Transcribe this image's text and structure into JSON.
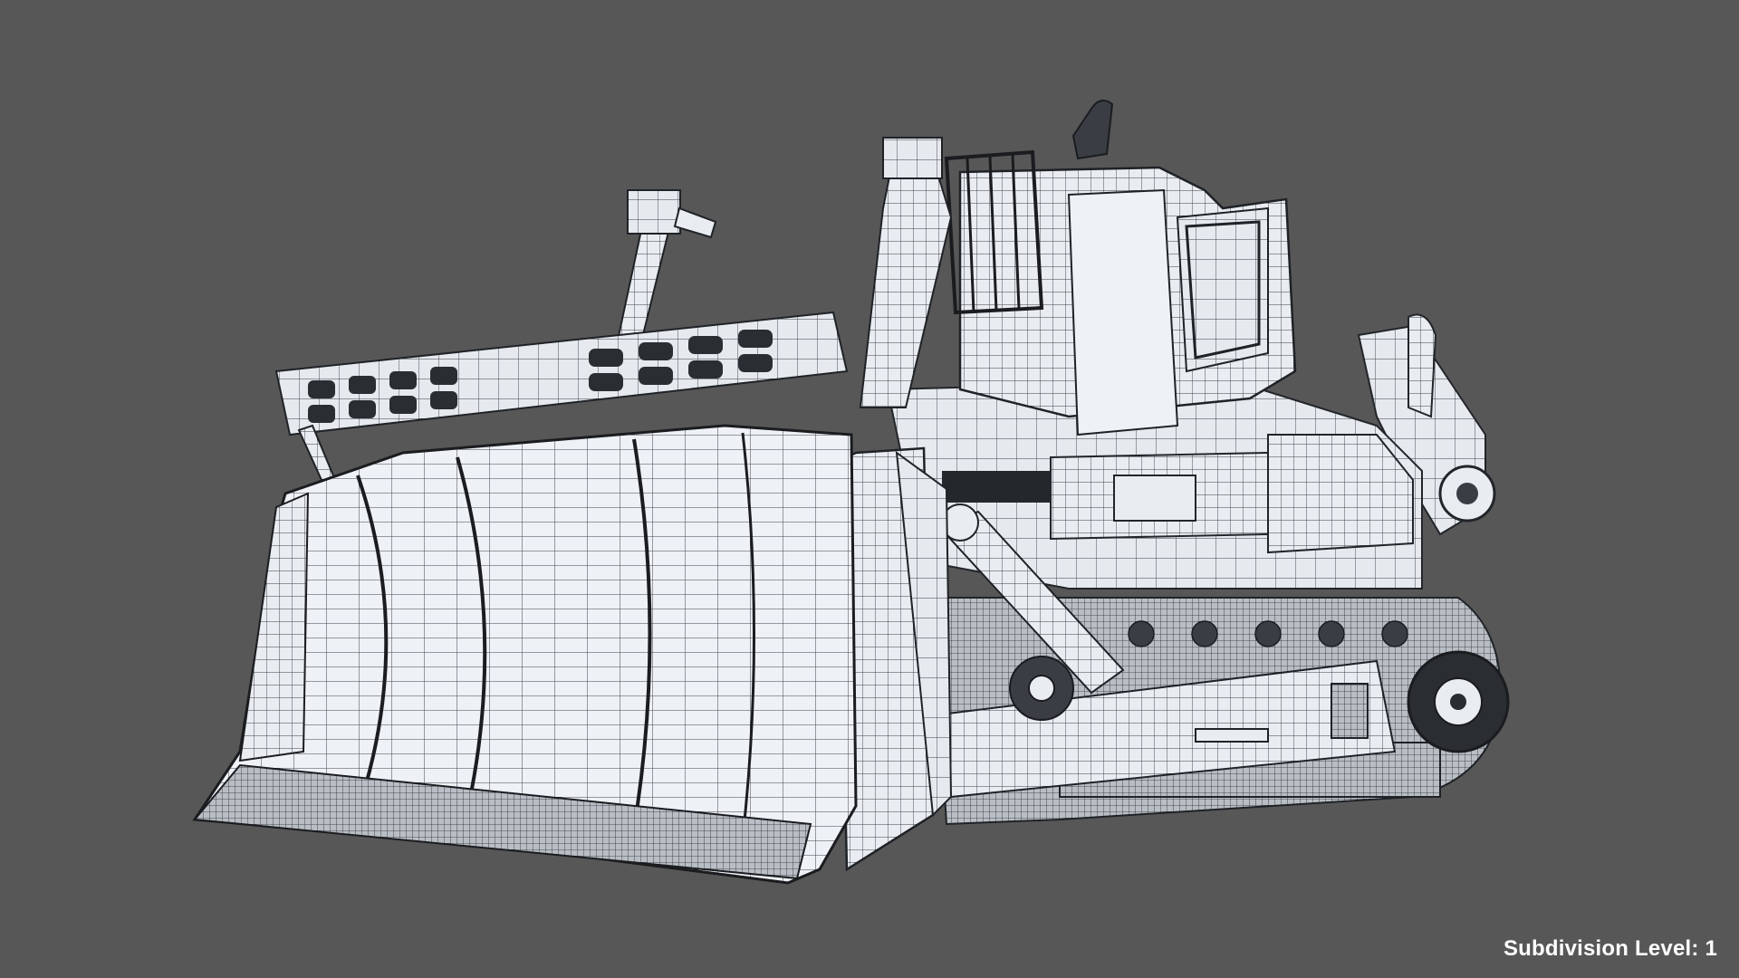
{
  "viewport": {
    "background_color": "#575757",
    "model_fill_color": "#e9edf2",
    "wireframe_color": "#2a2d31",
    "overlay": {
      "subdivision_text": "Subdivision Level: 1",
      "text_color": "#ffffff"
    }
  }
}
